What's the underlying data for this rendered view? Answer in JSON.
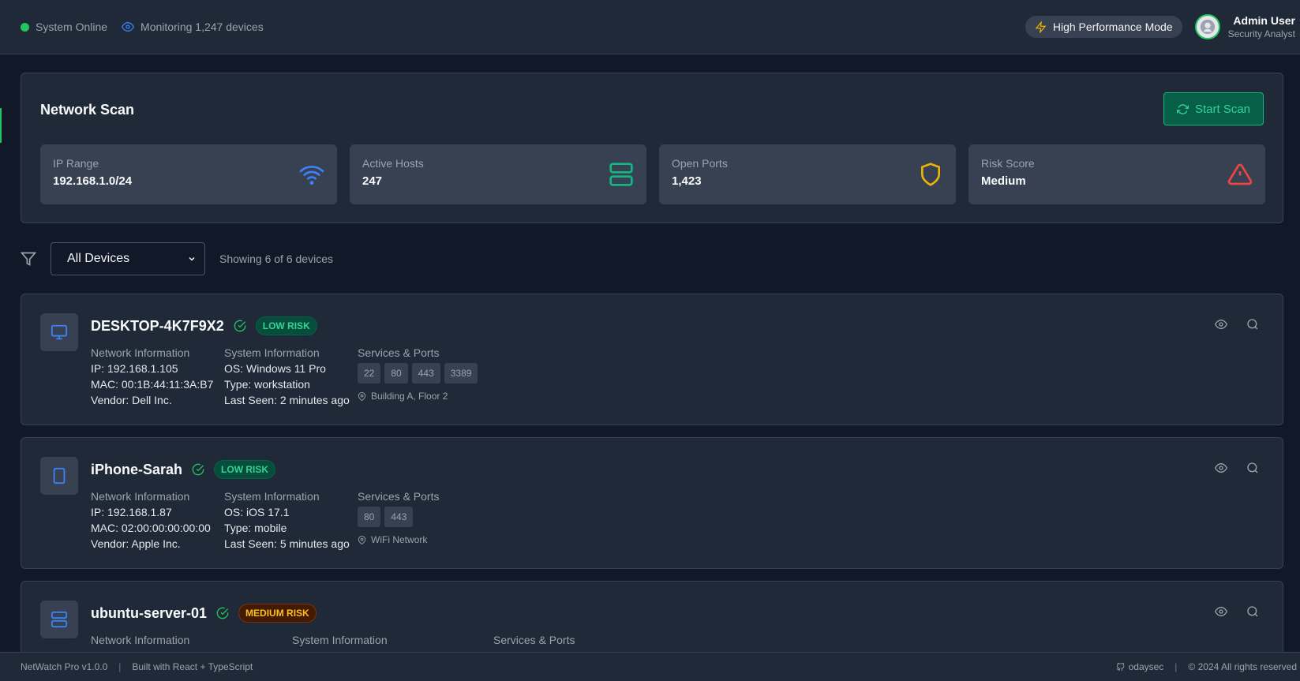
{
  "topbar": {
    "status": "System Online",
    "monitoring": "Monitoring 1,247 devices",
    "performance_mode": "High Performance Mode",
    "user_name": "Admin User",
    "user_role": "Security Analyst"
  },
  "scan": {
    "title": "Network Scan",
    "start_button": "Start Scan",
    "stats": [
      {
        "label": "IP Range",
        "value": "192.168.1.0/24",
        "icon": "wifi-icon",
        "color": "#3b82f6"
      },
      {
        "label": "Active Hosts",
        "value": "247",
        "icon": "server-icon",
        "color": "#10b981"
      },
      {
        "label": "Open Ports",
        "value": "1,423",
        "icon": "shield-icon",
        "color": "#eab308"
      },
      {
        "label": "Risk Score",
        "value": "Medium",
        "icon": "alert-triangle-icon",
        "color": "#ef4444"
      }
    ]
  },
  "filter": {
    "selected": "All Devices",
    "showing": "Showing 6 of 6 devices"
  },
  "devices": [
    {
      "name": "DESKTOP-4K7F9X2",
      "risk": "LOW RISK",
      "icon": "monitor-icon",
      "network_title": "Network Information",
      "ip": "IP: 192.168.1.105",
      "mac": "MAC: 00:1B:44:11:3A:B7",
      "vendor": "Vendor: Dell Inc.",
      "system_title": "System Information",
      "os": "OS: Windows 11 Pro",
      "type": "Type: workstation",
      "last_seen": "Last Seen: 2 minutes ago",
      "services_title": "Services & Ports",
      "ports": [
        "22",
        "80",
        "443",
        "3389"
      ],
      "location": "Building A, Floor 2"
    },
    {
      "name": "iPhone-Sarah",
      "risk": "LOW RISK",
      "icon": "smartphone-icon",
      "network_title": "Network Information",
      "ip": "IP: 192.168.1.87",
      "mac": "MAC: 02:00:00:00:00:00",
      "vendor": "Vendor: Apple Inc.",
      "system_title": "System Information",
      "os": "OS: iOS 17.1",
      "type": "Type: mobile",
      "last_seen": "Last Seen: 5 minutes ago",
      "services_title": "Services & Ports",
      "ports": [
        "80",
        "443"
      ],
      "location": "WiFi Network"
    },
    {
      "name": "ubuntu-server-01",
      "risk": "MEDIUM RISK",
      "icon": "server-icon",
      "network_title": "Network Information",
      "system_title": "System Information",
      "services_title": "Services & Ports"
    }
  ],
  "footer": {
    "version": "NetWatch Pro v1.0.0",
    "built_with": "Built with React + TypeScript",
    "author": "odaysec",
    "copyright": "© 2024 All rights reserved"
  },
  "colors": {
    "accent": "#22c55e",
    "low_risk": "#34d399",
    "medium_risk": "#fbbf24"
  }
}
